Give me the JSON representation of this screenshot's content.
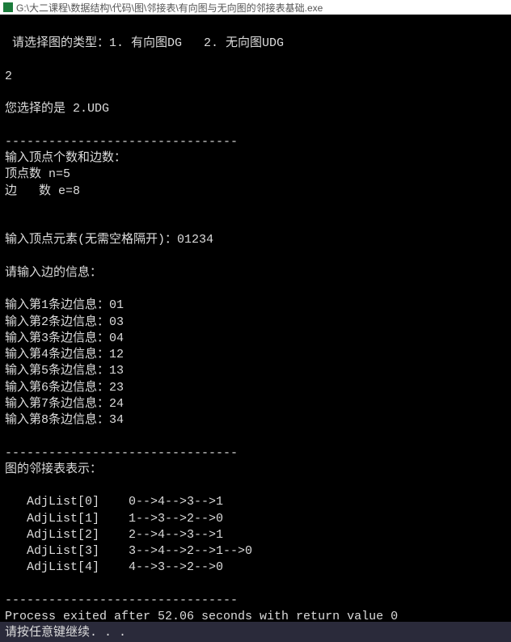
{
  "titlebar": {
    "path": "G:\\大二课程\\数据结构\\代码\\图\\邻接表\\有向图与无向图的邻接表基础.exe"
  },
  "console": {
    "prompt_select_type": " 请选择图的类型：1. 有向图DG   2. 无向图UDG",
    "user_input_type": "2",
    "selected_result": "您选择的是 2.UDG",
    "separator": "--------------------------------",
    "prompt_vertices_edges": "输入顶点个数和边数：",
    "vertex_count_line": "顶点数 n=5",
    "edge_count_line": "边   数 e=8",
    "prompt_vertex_elements": "输入顶点元素(无需空格隔开)：01234",
    "prompt_edges_header": "请输入边的信息：",
    "edges": [
      "输入第1条边信息：01",
      "输入第2条边信息：03",
      "输入第3条边信息：04",
      "输入第4条边信息：12",
      "输入第5条边信息：13",
      "输入第6条边信息：23",
      "输入第7条边信息：24",
      "输入第8条边信息：34"
    ],
    "adj_header": "图的邻接表表示：",
    "adj_list": [
      "   AdjList[0]    0-->4-->3-->1",
      "   AdjList[1]    1-->3-->2-->0",
      "   AdjList[2]    2-->4-->3-->1",
      "   AdjList[3]    3-->4-->2-->1-->0",
      "   AdjList[4]    4-->3-->2-->0"
    ],
    "process_exit": "Process exited after 52.06 seconds with return value 0",
    "press_key": "请按任意键继续. . ."
  }
}
